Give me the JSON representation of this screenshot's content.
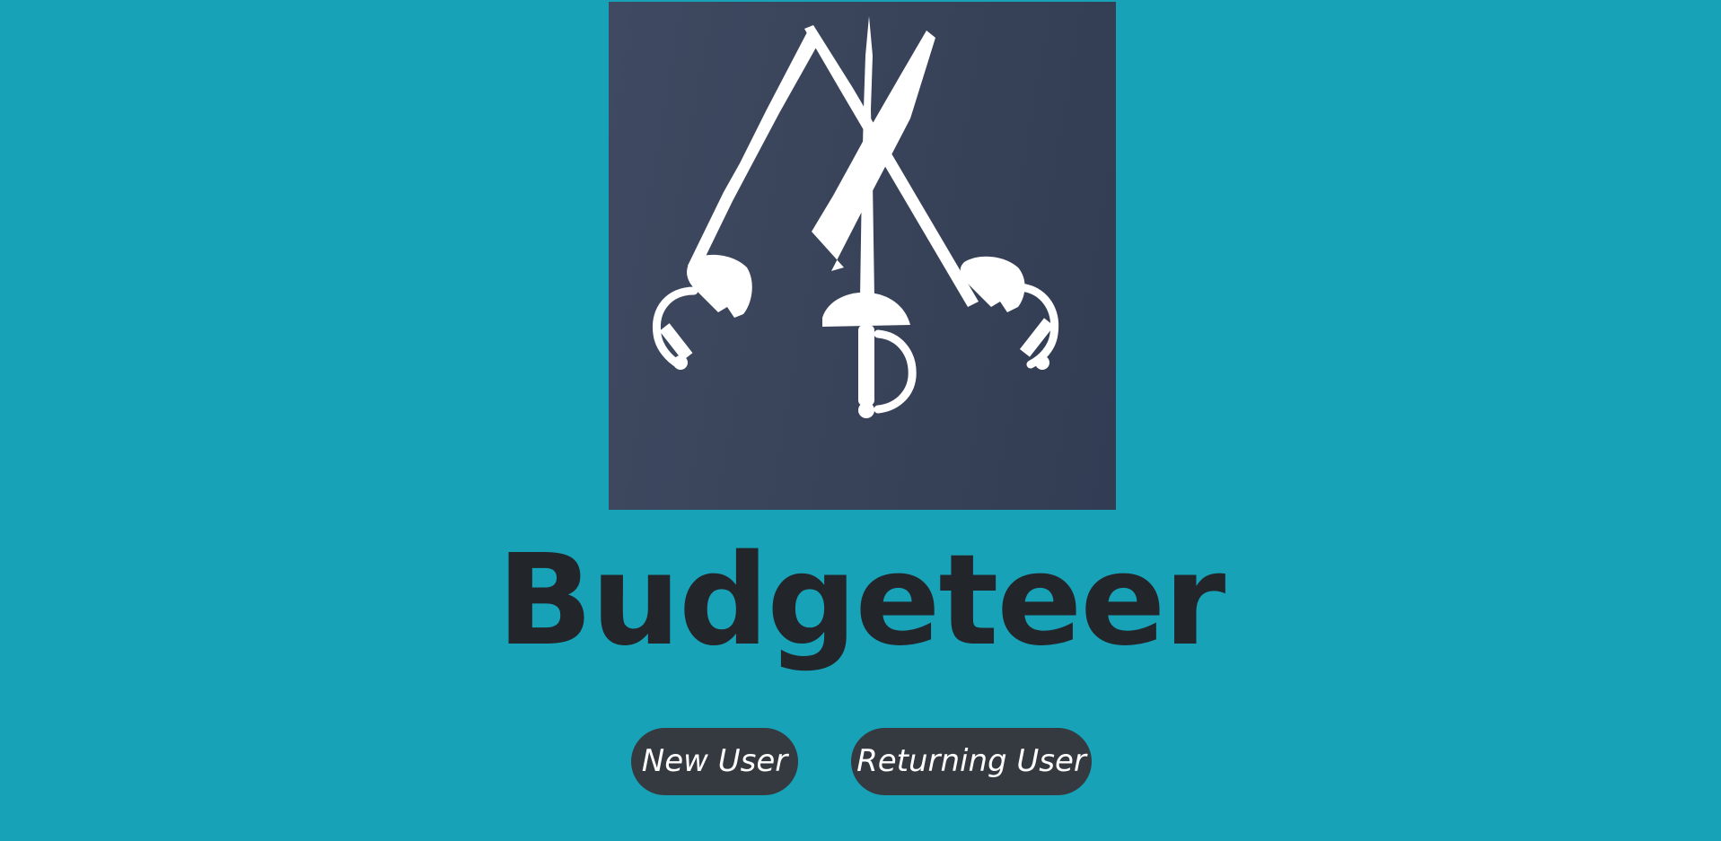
{
  "logo": {
    "icon": "crossed-swords-icon",
    "background_color": "#394359",
    "foreground_color": "#ffffff"
  },
  "title": "Budgeteer",
  "buttons": {
    "new_user": "New User",
    "returning_user": "Returning User"
  },
  "colors": {
    "page_background": "#17a2b8",
    "title_text": "#22262b",
    "button_background": "#343a40",
    "button_text": "#ffffff"
  }
}
